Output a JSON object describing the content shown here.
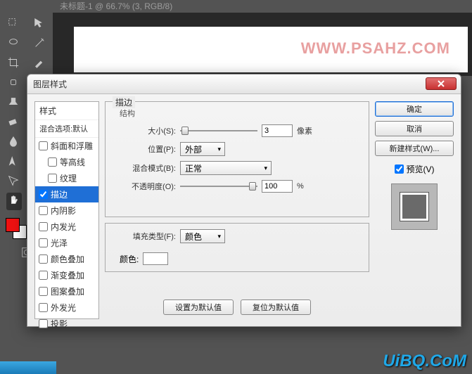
{
  "tab": {
    "title": "未标题-1 @ 66.7% (3, RGB/8)"
  },
  "watermark1": "WWW.PSAHZ.COM",
  "watermark2": "UiBQ.CoM",
  "dialog": {
    "title": "图层样式",
    "styles_header": "样式",
    "blend_options": "混合选项:默认",
    "items": [
      {
        "label": "斜面和浮雕",
        "checked": false,
        "indent": false,
        "selected": false
      },
      {
        "label": "等高线",
        "checked": false,
        "indent": true,
        "selected": false
      },
      {
        "label": "纹理",
        "checked": false,
        "indent": true,
        "selected": false
      },
      {
        "label": "描边",
        "checked": true,
        "indent": false,
        "selected": true
      },
      {
        "label": "内阴影",
        "checked": false,
        "indent": false,
        "selected": false
      },
      {
        "label": "内发光",
        "checked": false,
        "indent": false,
        "selected": false
      },
      {
        "label": "光泽",
        "checked": false,
        "indent": false,
        "selected": false
      },
      {
        "label": "颜色叠加",
        "checked": false,
        "indent": false,
        "selected": false
      },
      {
        "label": "渐变叠加",
        "checked": false,
        "indent": false,
        "selected": false
      },
      {
        "label": "图案叠加",
        "checked": false,
        "indent": false,
        "selected": false
      },
      {
        "label": "外发光",
        "checked": false,
        "indent": false,
        "selected": false
      },
      {
        "label": "投影",
        "checked": false,
        "indent": false,
        "selected": false
      }
    ],
    "panel_title": "描边",
    "structure_label": "结构",
    "size": {
      "label": "大小(S):",
      "value": "3",
      "unit": "像素"
    },
    "position": {
      "label": "位置(P):",
      "value": "外部"
    },
    "blend_mode": {
      "label": "混合模式(B):",
      "value": "正常"
    },
    "opacity": {
      "label": "不透明度(O):",
      "value": "100",
      "unit": "%"
    },
    "fill_type": {
      "label": "填充类型(F):",
      "value": "颜色"
    },
    "color_label": "颜色:",
    "make_default": "设置为默认值",
    "reset_default": "复位为默认值",
    "ok": "确定",
    "cancel": "取消",
    "new_style": "新建样式(W)...",
    "preview": "预览(V)"
  }
}
